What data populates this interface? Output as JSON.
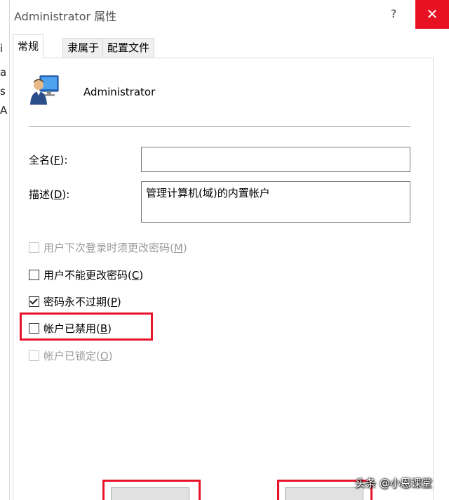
{
  "background": {
    "fragments": [
      "i",
      "a",
      "s",
      "A"
    ]
  },
  "window": {
    "title": "Administrator 属性",
    "help_glyph": "?",
    "close_glyph": "✕"
  },
  "tabs": [
    {
      "label": "常规",
      "active": true
    },
    {
      "label": "隶属于",
      "active": false
    },
    {
      "label": "配置文件",
      "active": false
    }
  ],
  "general": {
    "user_icon": "user-icon",
    "user_name": "Administrator",
    "full_name": {
      "prefix": "全名(",
      "key": "F",
      "suffix": "):",
      "value": ""
    },
    "description": {
      "prefix": "描述(",
      "key": "D",
      "suffix": "):",
      "value": "管理计算机(域)的内置帐户"
    },
    "options": [
      {
        "prefix": "用户下次登录时须更改密码(",
        "key": "M",
        "suffix": ")",
        "checked": false,
        "enabled": false
      },
      {
        "prefix": "用户不能更改密码(",
        "key": "C",
        "suffix": ")",
        "checked": false,
        "enabled": true
      },
      {
        "prefix": "密码永不过期(",
        "key": "P",
        "suffix": ")",
        "checked": true,
        "enabled": true
      },
      {
        "prefix": "帐户已禁用(",
        "key": "B",
        "suffix": ")",
        "checked": false,
        "enabled": true
      },
      {
        "prefix": "帐户已锁定(",
        "key": "O",
        "suffix": ")",
        "checked": false,
        "enabled": false
      }
    ]
  },
  "annotation_color": "#e8142a",
  "accent_close": "#e81123",
  "watermark": "头条 @小恩课堂"
}
